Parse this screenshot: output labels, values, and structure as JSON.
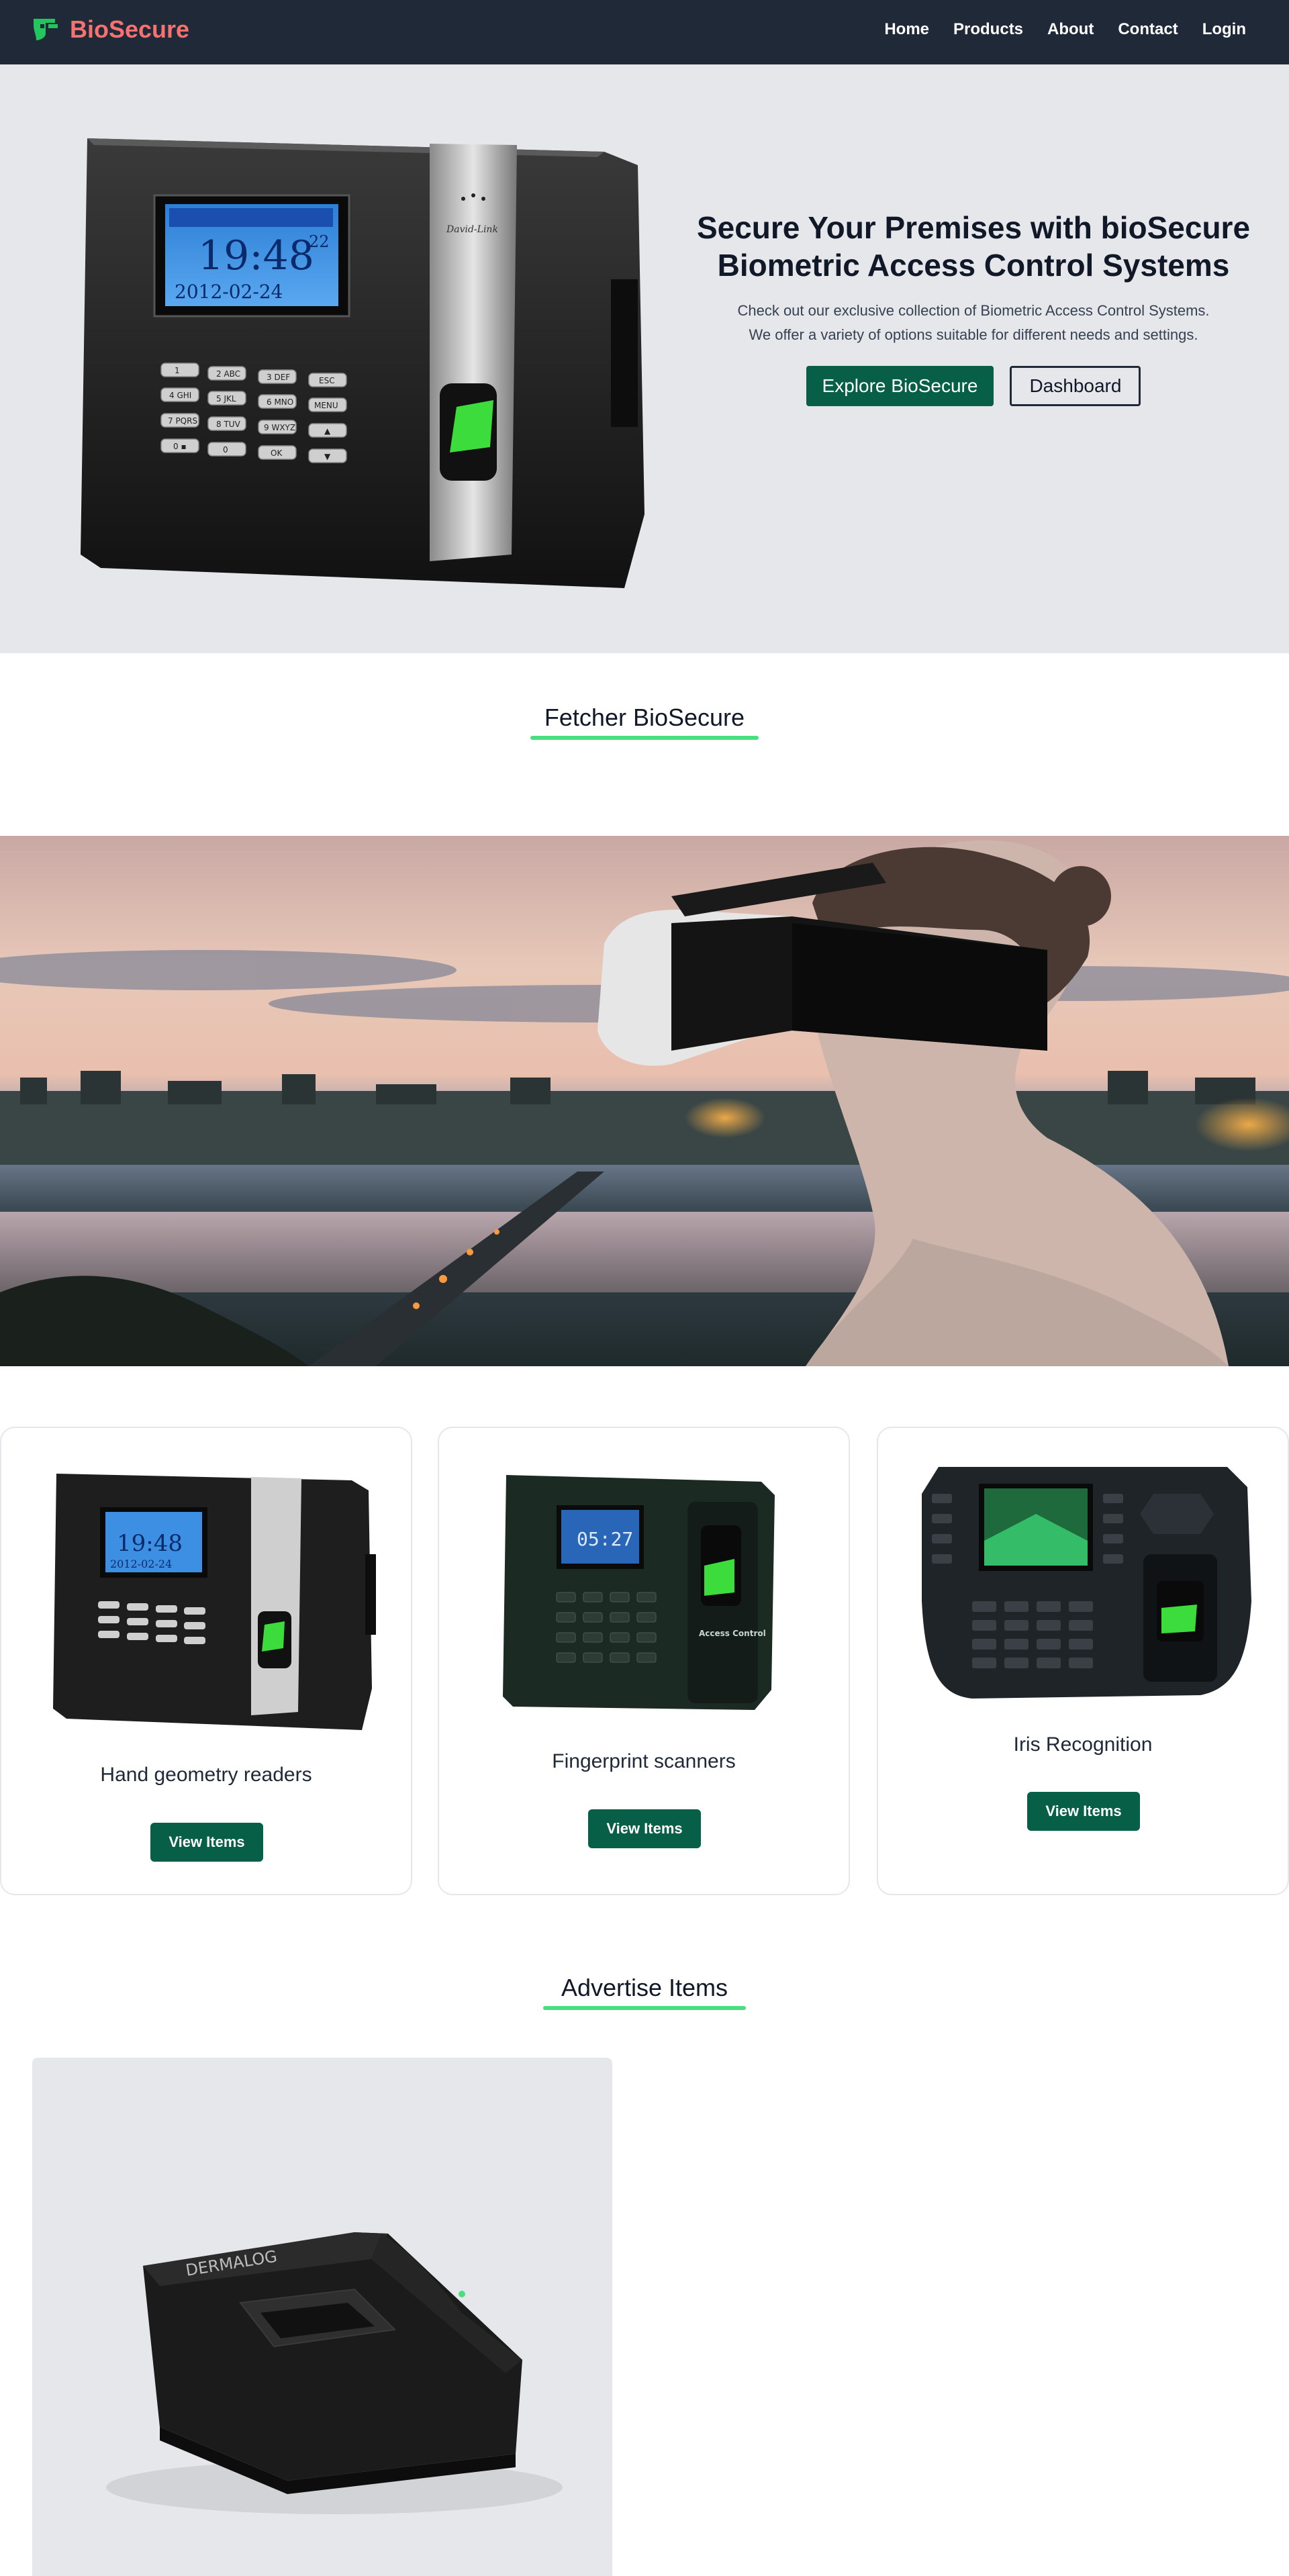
{
  "nav": {
    "brand": "BioSecure",
    "links": [
      "Home",
      "Products",
      "About",
      "Contact",
      "Login"
    ]
  },
  "hero": {
    "title_line1": "Secure Your Premises with bioSecure",
    "title_line2": "Biometric Access Control Systems",
    "sub_line1": "Check out our exclusive collection of Biometric Access Control Systems.",
    "sub_line2": "We offer a variety of options suitable for different needs and settings.",
    "primary_button": "Explore BioSecure",
    "secondary_button": "Dashboard",
    "device": {
      "time": "19:48",
      "seconds": "22",
      "date": "2012-02-24",
      "brand_script": "David-Link",
      "keys": [
        "1",
        "2 ABC",
        "3 DEF",
        "ESC",
        "4 GHI",
        "5 JKL",
        "6 MNO",
        "MENU",
        "7 PQRS",
        "8 TUV",
        "9 WXYZ",
        "▲",
        "0 ▪",
        "0",
        "OK",
        "▼"
      ]
    }
  },
  "features_section": {
    "title": "Fetcher BioSecure"
  },
  "categories": [
    {
      "title": "Hand geometry readers",
      "button": "View Items"
    },
    {
      "title": "Fingerprint scanners",
      "button": "View Items",
      "screen_time": "05:27",
      "label": "Access Control"
    },
    {
      "title": "Iris Recognition",
      "button": "View Items"
    }
  ],
  "advertise_section": {
    "title": "Advertise Items",
    "item_brand": "DERMALOG"
  },
  "colors": {
    "nav_bg": "#1f2937",
    "brand": "#f87171",
    "accent_green": "#065f46",
    "underline": "#4ade80",
    "hero_bg": "#e5e7eb"
  }
}
